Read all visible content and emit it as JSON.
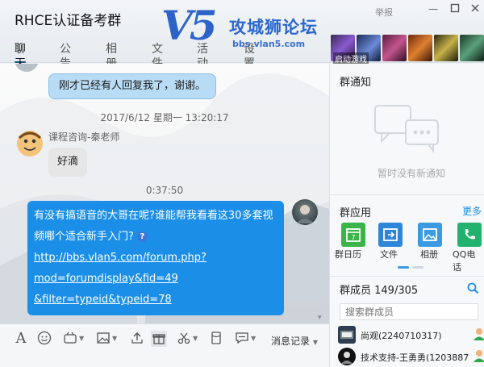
{
  "window": {
    "group_title": "RHCE认证备考群",
    "report_label": "举报",
    "controls": [
      "min",
      "max",
      "close"
    ]
  },
  "watermark": {
    "logo_text": "V5",
    "site_name": "攻城狮论坛",
    "site_url": "bbs.vlan5.com"
  },
  "tabs": [
    {
      "label": "聊天",
      "active": true
    },
    {
      "label": "公告",
      "active": false
    },
    {
      "label": "相册",
      "active": false
    },
    {
      "label": "文件",
      "active": false
    },
    {
      "label": "活动",
      "active": false
    },
    {
      "label": "设置",
      "active": false
    }
  ],
  "app_strip": {
    "overlay_label": "启动游戏"
  },
  "chat": {
    "messages": [
      {
        "type": "bubble",
        "text": "刚才已经有人回复我了，谢谢。"
      },
      {
        "type": "timestamp",
        "text": "2017/6/12 星期一 13:20:17"
      },
      {
        "type": "bubble",
        "sender": "课程咨询-秦老师",
        "text": "好滴"
      },
      {
        "type": "timestamp",
        "text": "0:37:50"
      },
      {
        "type": "bubble",
        "sender": "me",
        "text_line1": "有没有搞语音的大哥在呢?谁能帮我看看这30多套视",
        "text_line2": "频哪个适合新手入门?",
        "link_line1": "http://bbs.vlan5.com/forum.php?",
        "link_line2": "mod=forumdisplay&fid=49",
        "link_line3": "&filter=typeid&typeid=78"
      }
    ]
  },
  "toolbar": {
    "message_record_label": "消息记录"
  },
  "side": {
    "notice_title": "群通知",
    "notice_empty": "暂时没有新通知",
    "apps_title": "群应用",
    "more_label": "更多",
    "apps": [
      {
        "label": "群日历",
        "color": "#3bb54a"
      },
      {
        "label": "文件",
        "color": "#2f86d8"
      },
      {
        "label": "相册",
        "color": "#3a9be0"
      },
      {
        "label": "QQ电话",
        "color": "#23b26d"
      }
    ],
    "members_title": "群成员 149/305",
    "member_search_placeholder": "搜索群成员",
    "members": [
      {
        "name": "尚观(2240710317)"
      },
      {
        "name": "技术支持-王勇勇(1203887"
      }
    ]
  },
  "colors": {
    "accent": "#1a9be8",
    "self_bubble": "#1b8fe8",
    "other_bubble": "#b8dcf5"
  }
}
